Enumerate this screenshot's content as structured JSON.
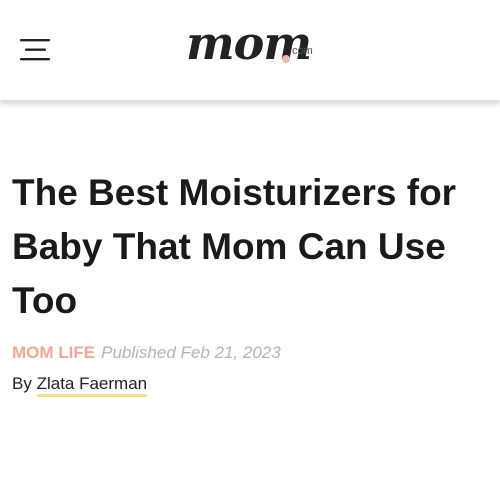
{
  "header": {
    "menu_icon": "hamburger-menu-icon",
    "logo": {
      "word": "mom",
      "suffix": ".com",
      "dot_color": "#f2b8a8"
    }
  },
  "article": {
    "title": "The Best Moisturizers for Baby That Mom Can Use Too",
    "category": "MOM LIFE",
    "published": "Published Feb 21, 2023",
    "byline_prefix": "By",
    "author": "Zlata Faerman"
  },
  "colors": {
    "category": "#f0a892",
    "author_underline": "#f6e08a",
    "title": "#1a1a1a"
  }
}
